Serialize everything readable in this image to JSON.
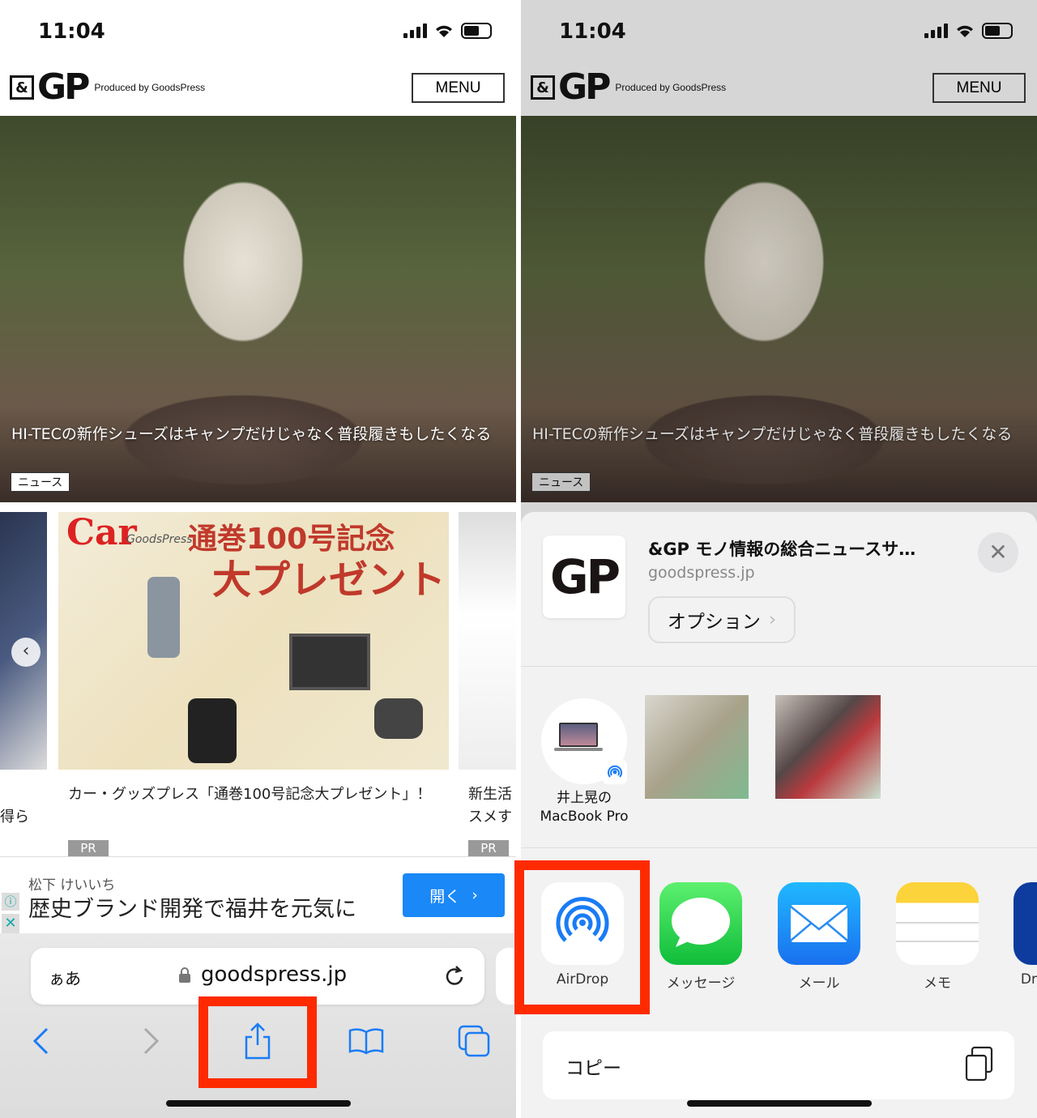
{
  "status": {
    "time": "11:04"
  },
  "site": {
    "logo_amp": "&",
    "logo_gp": "GP",
    "produced_by": "Produced by GoodsPress",
    "menu_label": "MENU"
  },
  "hero": {
    "title": "HI-TECの新作シューズはキャンプだけじゃなく普段履きもしたくなる",
    "tag": "ニュース"
  },
  "carousel": {
    "banner_brand": "Car",
    "banner_sub": "GoodsPress",
    "banner_headline_1": "通巻100号記念",
    "banner_headline_2": "大プレゼント",
    "captions": [
      {
        "text": "得ら",
        "badge": ""
      },
      {
        "text": "カー・グッズプレス「通巻100号記念大プレゼント」！",
        "badge": "PR"
      },
      {
        "text": "新生活スメす",
        "badge": "PR"
      }
    ]
  },
  "ad": {
    "advertiser": "松下 けいいち",
    "headline": "歴史ブランド開発で福井を元気に",
    "open_label": "開く"
  },
  "safari": {
    "aa_label": "ぁあ",
    "url": "goodspress.jp",
    "icons": [
      "back-icon",
      "forward-icon",
      "share-icon",
      "bookmarks-icon",
      "tabs-icon"
    ]
  },
  "share_sheet": {
    "title": "&GP モノ情報の総合ニュースサ…",
    "domain": "goodspress.jp",
    "thumb_text": "GP",
    "options_label": "オプション",
    "airdrop_device": {
      "line1": "井上晃の",
      "line2": "MacBook Pro"
    },
    "apps": [
      {
        "label": "AirDrop",
        "icon": "airdrop-icon"
      },
      {
        "label": "メッセージ",
        "icon": "messages-icon"
      },
      {
        "label": "メール",
        "icon": "mail-icon"
      },
      {
        "label": "メモ",
        "icon": "notes-icon"
      },
      {
        "label": "Dr",
        "icon": "dropbox-icon"
      }
    ],
    "copy_label": "コピー"
  },
  "colors": {
    "highlight": "#ff2a00",
    "ios_blue": "#1a88f7",
    "ad_button": "#1a88f7"
  }
}
